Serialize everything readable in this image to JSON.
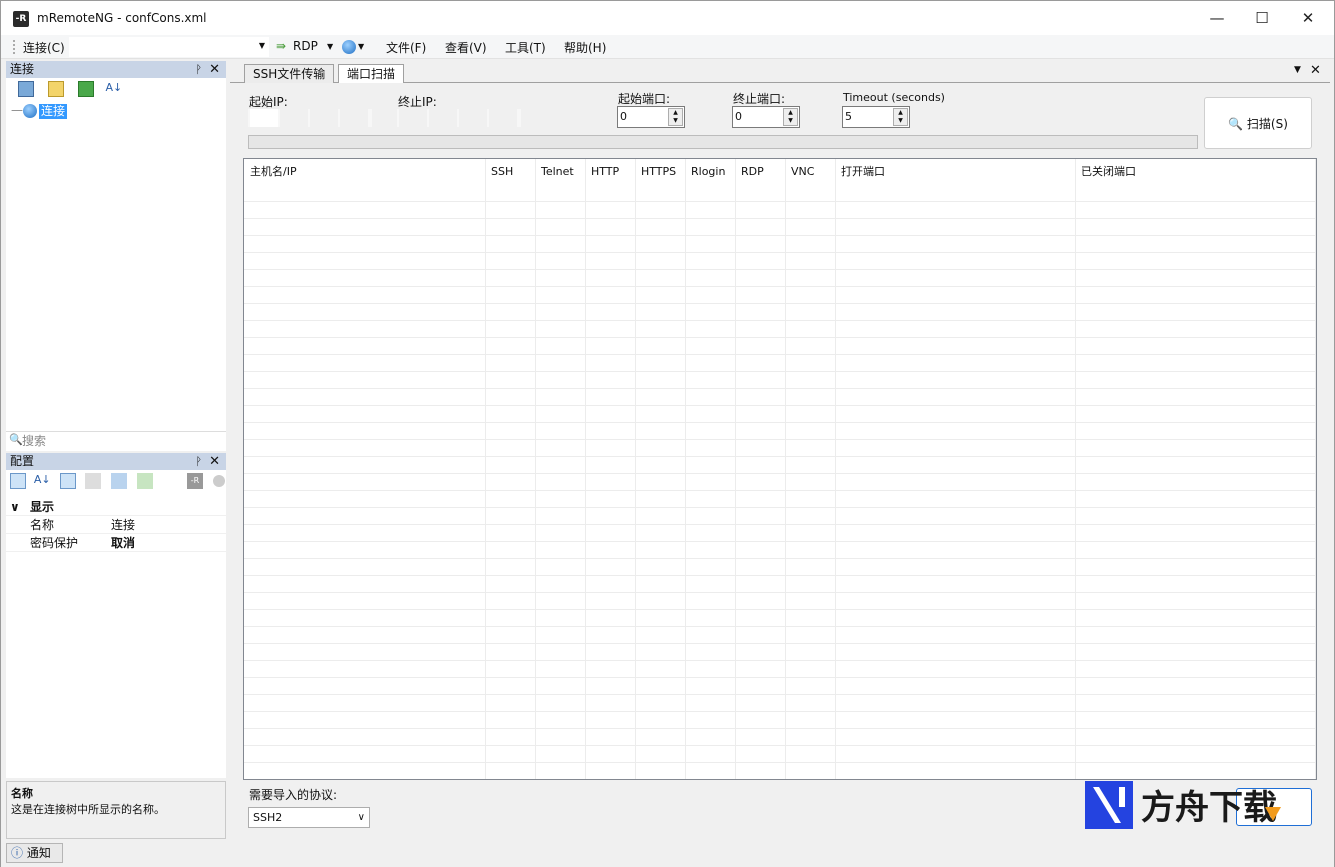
{
  "window": {
    "title": "mRemoteNG - confCons.xml",
    "minimize": "—",
    "maximize": "☐",
    "close": "✕"
  },
  "menubar": {
    "connect_label": "连接(C)",
    "rdp_label": "RDP",
    "items": [
      "文件(F)",
      "查看(V)",
      "工具(T)",
      "帮助(H)"
    ]
  },
  "connections_panel": {
    "title": "连接",
    "pin": "ᚹ",
    "close": "✕",
    "tree_root": "连接",
    "search_placeholder": "搜索"
  },
  "config_panel": {
    "title": "配置",
    "pin": "ᚹ",
    "close": "✕",
    "category": "显示",
    "rows": [
      {
        "name": "名称",
        "value": "连接"
      },
      {
        "name": "密码保护",
        "value": "取消"
      }
    ]
  },
  "description": {
    "title": "名称",
    "text": "这是在连接树中所显示的名称。"
  },
  "tabs": [
    {
      "label": "SSH文件传输"
    },
    {
      "label": "端口扫描"
    }
  ],
  "scan": {
    "start_ip_label": "起始IP:",
    "end_ip_label": "终止IP:",
    "start_port_label": "起始端口:",
    "start_port": "0",
    "end_port_label": "终止端口:",
    "end_port": "0",
    "timeout_label": "Timeout (seconds)",
    "timeout": "5",
    "scan_button": "扫描(S)",
    "columns": [
      "主机名/IP",
      "SSH",
      "Telnet",
      "HTTP",
      "HTTPS",
      "Rlogin",
      "RDP",
      "VNC",
      "打开端口",
      "已关闭端口"
    ],
    "import_label": "需要导入的协议:",
    "import_value": "SSH2"
  },
  "statusbar": {
    "notify": "通知"
  },
  "watermark": {
    "text": "方舟下载"
  }
}
